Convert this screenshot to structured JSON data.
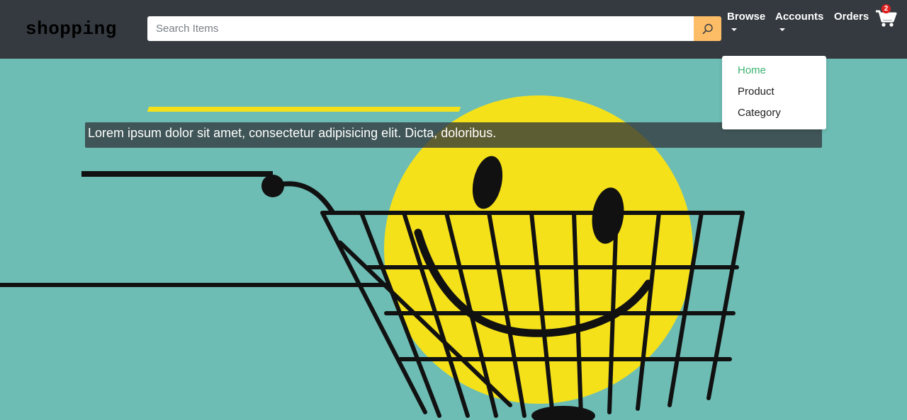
{
  "navbar": {
    "brand": "shopping",
    "search": {
      "placeholder": "Search Items",
      "value": ""
    },
    "links": {
      "browse": "Browse",
      "accounts": "Accounts",
      "orders": "Orders"
    },
    "cart_count": "2"
  },
  "dropdown": {
    "items": [
      {
        "label": "Home",
        "active": true
      },
      {
        "label": "Product",
        "active": false
      },
      {
        "label": "Category",
        "active": false
      }
    ]
  },
  "hero": {
    "caption": "Lorem ipsum dolor sit amet, consectetur adipisicing elit. Dicta, doloribus."
  },
  "colors": {
    "navbar": "#343a40",
    "search_button": "#fdbd67",
    "hero_background": "#6dbdb5",
    "smiley": "#f5e11a",
    "active_link": "#3cb371"
  }
}
